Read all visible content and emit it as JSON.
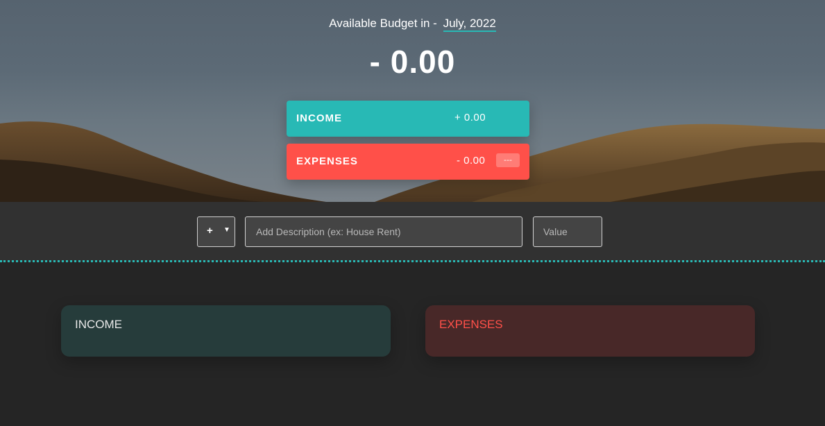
{
  "header": {
    "budget_title": "Available Budget in -",
    "month": "July, 2022",
    "budget_value": "- 0.00"
  },
  "summary": {
    "income": {
      "label": "Income",
      "value": "+ 0.00"
    },
    "expenses": {
      "label": "Expenses",
      "value": "- 0.00",
      "percentage": "---"
    }
  },
  "add_bar": {
    "type_selected": "+",
    "description_placeholder": "Add Description (ex: House Rent)",
    "value_placeholder": "Value"
  },
  "lists": {
    "income_title": "Income",
    "expenses_title": "Expenses"
  },
  "colors": {
    "income": "#28b9b5",
    "expenses": "#ff5049"
  },
  "icons": {
    "type_dropdown": "chevron-down-icon"
  }
}
